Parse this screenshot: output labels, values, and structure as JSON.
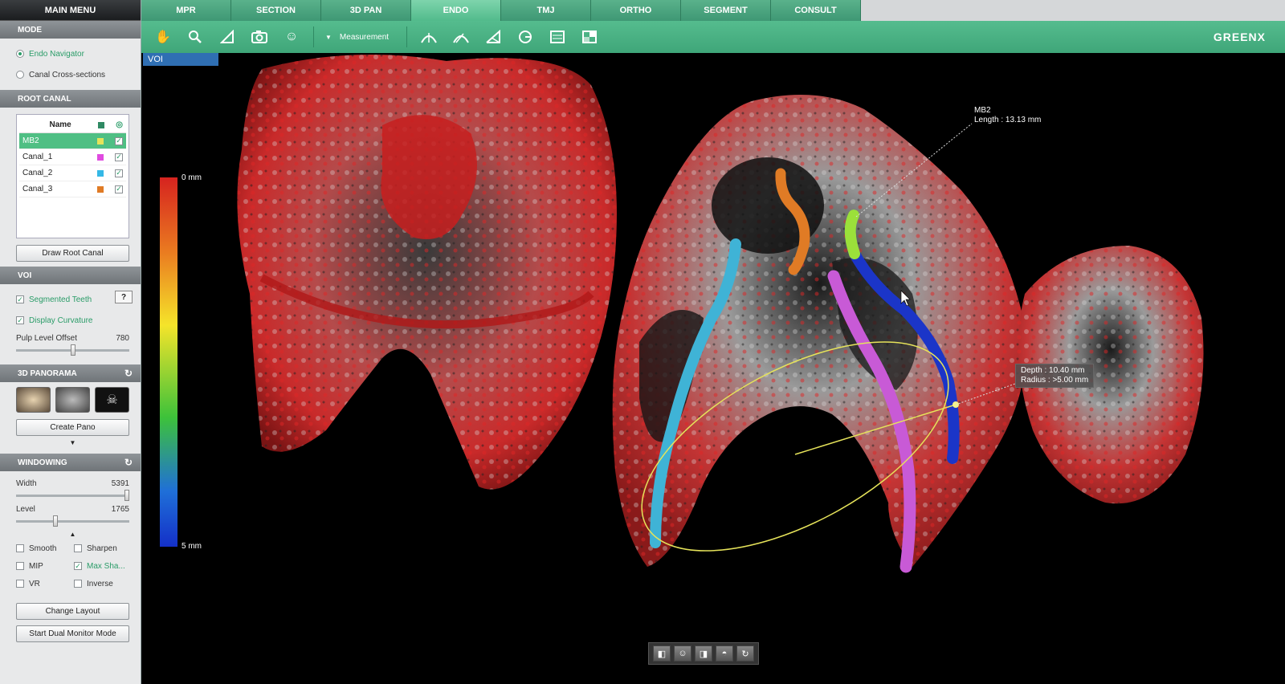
{
  "sidebar": {
    "main_menu": "MAIN MENU",
    "mode": {
      "title": "MODE",
      "options": [
        {
          "label": "Endo Navigator",
          "selected": true
        },
        {
          "label": "Canal Cross-sections",
          "selected": false
        }
      ]
    },
    "root_canal": {
      "title": "ROOT CANAL",
      "col_name": "Name",
      "rows": [
        {
          "name": "MB2",
          "color": "#e6e35a",
          "visible": true,
          "selected": true
        },
        {
          "name": "Canal_1",
          "color": "#e04be0",
          "visible": true,
          "selected": false
        },
        {
          "name": "Canal_2",
          "color": "#35b8e6",
          "visible": true,
          "selected": false
        },
        {
          "name": "Canal_3",
          "color": "#e07b25",
          "visible": true,
          "selected": false
        }
      ],
      "draw_button": "Draw Root Canal"
    },
    "voi": {
      "title": "VOI",
      "segmented_teeth": "Segmented Teeth",
      "display_curvature": "Display Curvature",
      "help": "?",
      "pulp_label": "Pulp Level Offset",
      "pulp_value": "780",
      "pulp_fraction": 0.5
    },
    "panorama": {
      "title": "3D PANORAMA",
      "create_button": "Create Pano"
    },
    "windowing": {
      "title": "WINDOWING",
      "width_label": "Width",
      "width_value": "5391",
      "width_fraction": 0.98,
      "level_label": "Level",
      "level_value": "1765",
      "level_fraction": 0.35,
      "options": [
        {
          "label": "Smooth",
          "checked": false
        },
        {
          "label": "Sharpen",
          "checked": false
        },
        {
          "label": "MIP",
          "checked": false
        },
        {
          "label": "Max Sha...",
          "checked": true
        },
        {
          "label": "VR",
          "checked": false
        },
        {
          "label": "Inverse",
          "checked": false
        }
      ]
    },
    "change_layout": "Change Layout",
    "dual_monitor": "Start Dual Monitor Mode"
  },
  "tabs": [
    {
      "label": "MPR",
      "active": false
    },
    {
      "label": "SECTION",
      "active": false
    },
    {
      "label": "3D PAN",
      "active": false
    },
    {
      "label": "ENDO",
      "active": true
    },
    {
      "label": "TMJ",
      "active": false
    },
    {
      "label": "ORTHO",
      "active": false
    },
    {
      "label": "SEGMENT",
      "active": false
    },
    {
      "label": "CONSULT",
      "active": false
    }
  ],
  "toolbar": {
    "measurement_label": "Measurement",
    "brand": "GREENX"
  },
  "viewport": {
    "voi_label": "VOI",
    "scale_top": "0 mm",
    "scale_bottom": "5 mm",
    "mb2_name": "MB2",
    "mb2_length": "Length : 13.13 mm",
    "depth": "Depth : 10.40 mm",
    "radius": "Radius : >5.00 mm"
  },
  "colors": {
    "accent": "#4bb587",
    "selected_row": "#4fbf84",
    "voi_tab": "#2f6fb3"
  }
}
